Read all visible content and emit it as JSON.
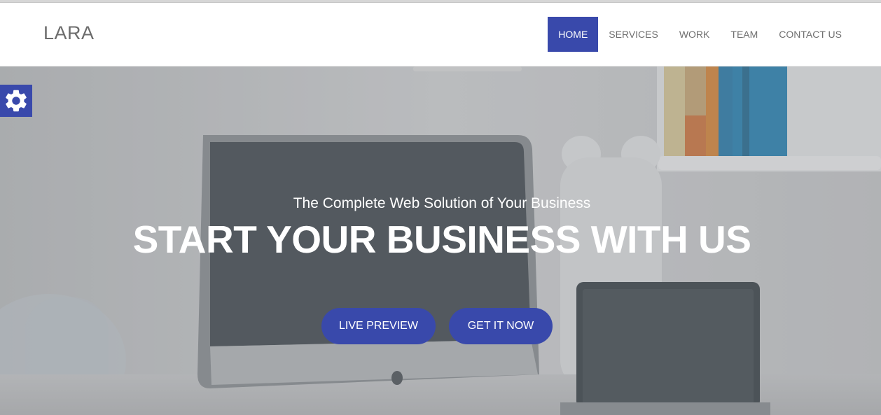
{
  "brand": "LARA",
  "nav": {
    "items": [
      {
        "label": "HOME",
        "active": true
      },
      {
        "label": "SERVICES",
        "active": false
      },
      {
        "label": "WORK",
        "active": false
      },
      {
        "label": "TEAM",
        "active": false
      },
      {
        "label": "CONTACT US",
        "active": false
      }
    ]
  },
  "hero": {
    "subtitle": "The Complete Web Solution of Your Business",
    "title": "START YOUR BUSINESS WITH US",
    "buttons": {
      "live_preview": "LIVE PREVIEW",
      "get_it_now": "GET IT NOW"
    }
  },
  "settings_tab": {
    "icon": "gear-icon"
  },
  "colors": {
    "accent": "#3949ab",
    "nav_text": "#6f6f6f",
    "brand_text": "#6c6c6c"
  }
}
